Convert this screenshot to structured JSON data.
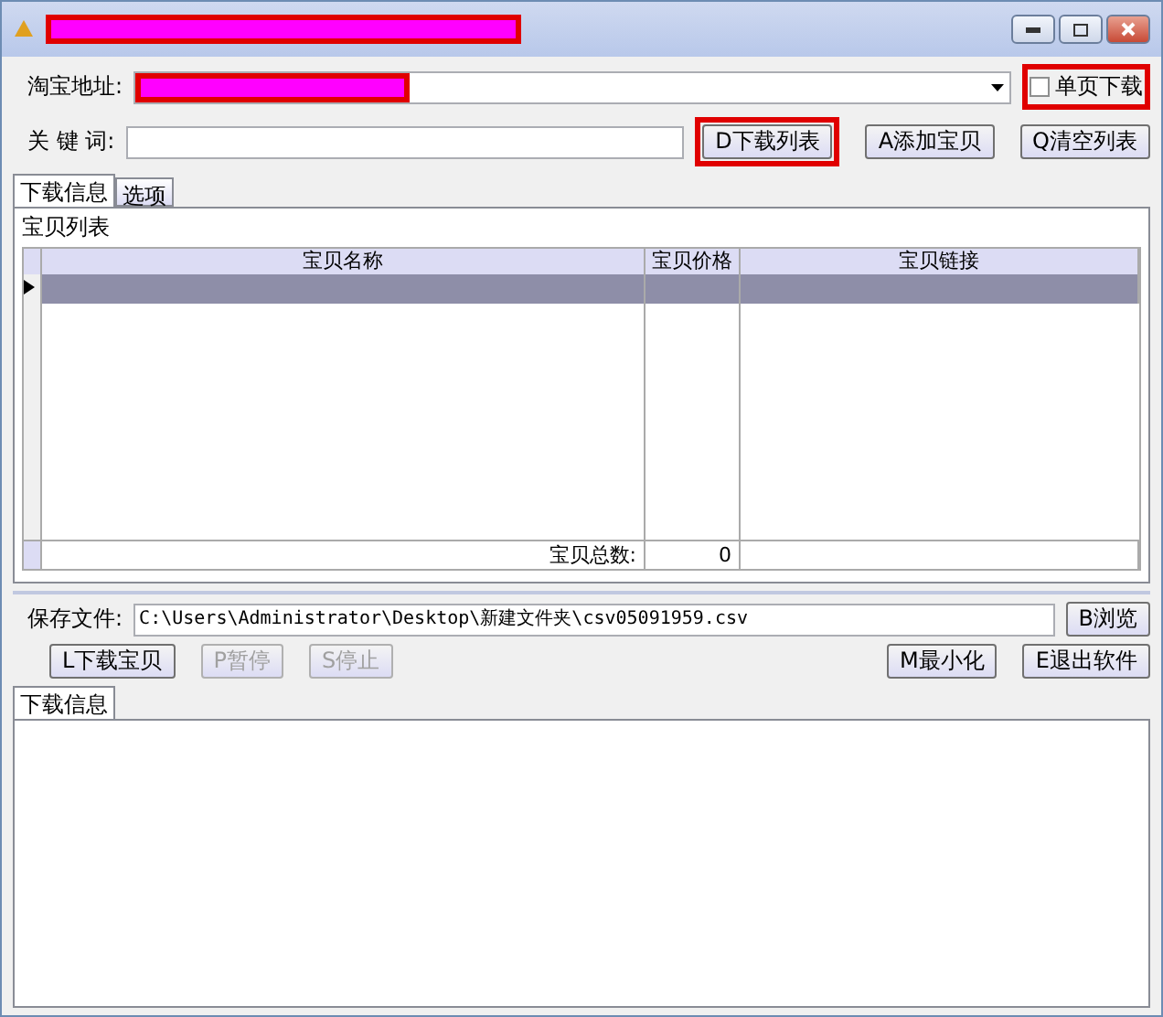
{
  "url_row": {
    "label": "淘宝地址:"
  },
  "single_page": {
    "label": "单页下载",
    "checked": false,
    "highlighted": true
  },
  "keyword_row": {
    "label": "关 键 词:"
  },
  "top_buttons": [
    {
      "label": "D下载列表",
      "highlighted": true
    },
    {
      "label": "A添加宝贝",
      "highlighted": false
    },
    {
      "label": "Q清空列表",
      "highlighted": false
    }
  ],
  "tabs": [
    {
      "label": "下载信息",
      "selected": true
    },
    {
      "label": "选项",
      "selected": false
    }
  ],
  "group": {
    "title": "宝贝列表"
  },
  "table": {
    "columns": [
      "宝贝名称",
      "宝贝价格",
      "宝贝链接"
    ],
    "rows": [
      {
        "selected": true
      }
    ],
    "footer": {
      "label": "宝贝总数:",
      "count": "0"
    }
  },
  "save_file": {
    "label": "保存文件:",
    "value": "C:\\Users\\Administrator\\Desktop\\新建文件夹\\csv05091959.csv",
    "browse": "B浏览"
  },
  "action_buttons": [
    {
      "label": "L下载宝贝",
      "disabled": false
    },
    {
      "label": "P暂停",
      "disabled": true
    },
    {
      "label": "S停止",
      "disabled": true
    }
  ],
  "right_buttons": [
    {
      "label": "M最小化",
      "disabled": false
    },
    {
      "label": "E退出软件",
      "disabled": false
    }
  ],
  "log_tabs": [
    {
      "label": "下载信息",
      "selected": true
    }
  ]
}
